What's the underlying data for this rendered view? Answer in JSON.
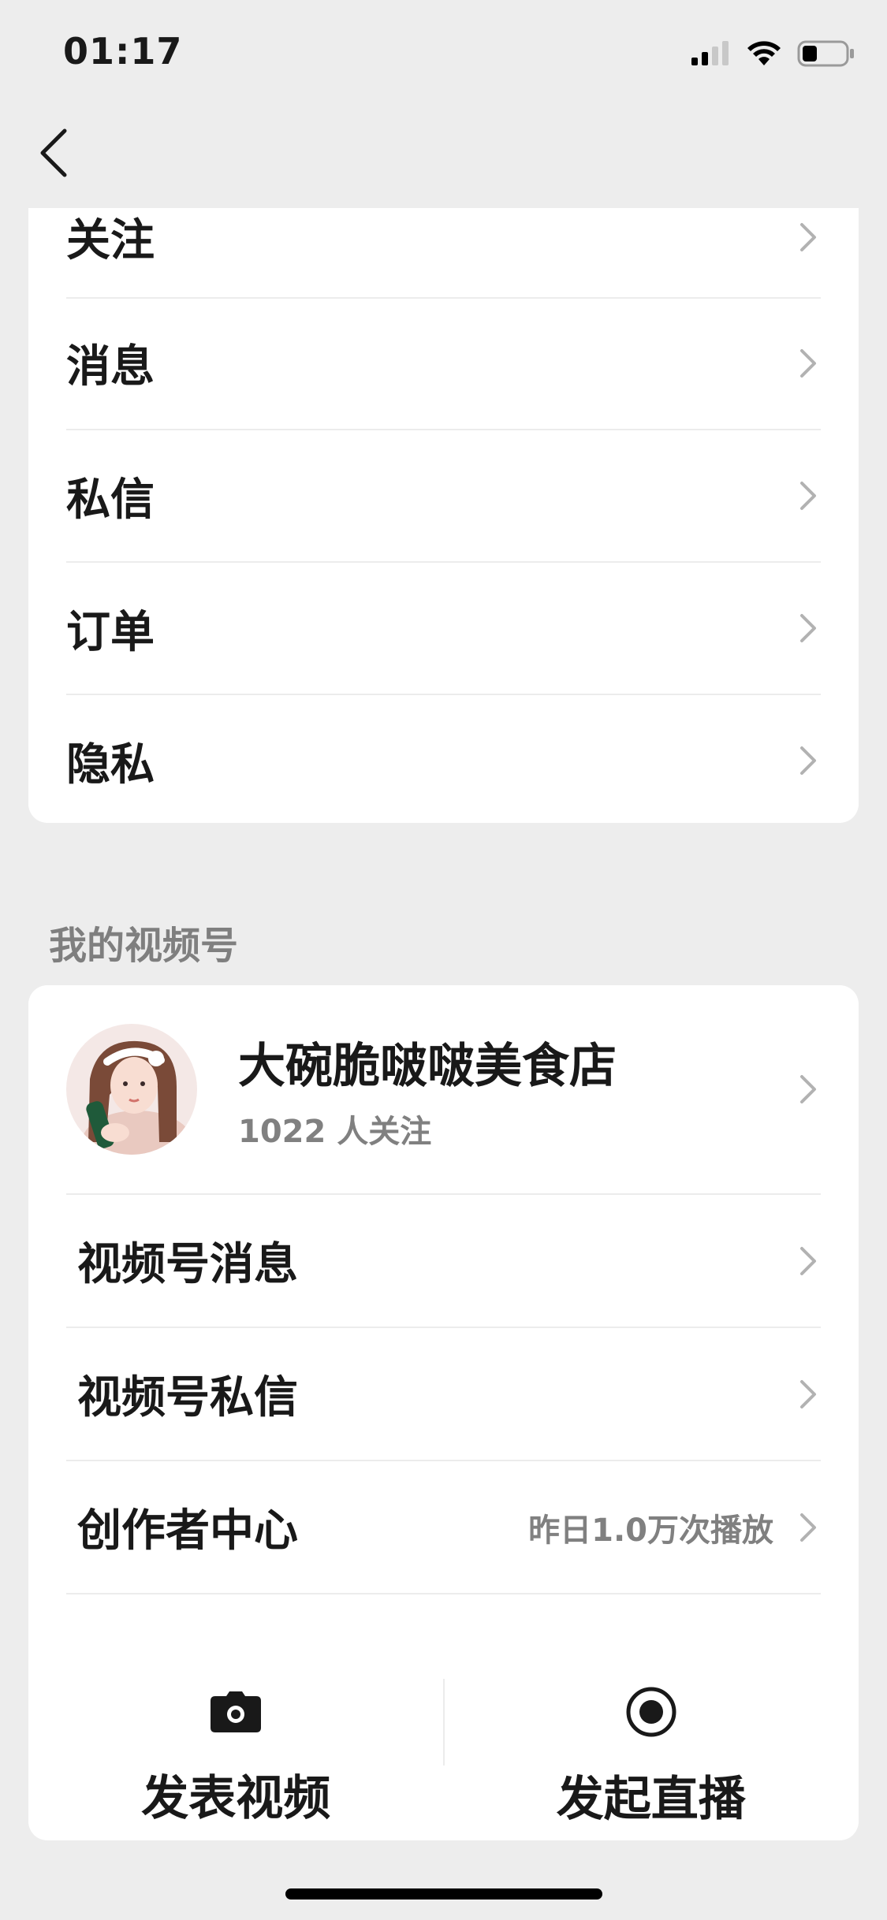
{
  "status_bar": {
    "time": "01:17",
    "icons": [
      "signal-icon",
      "wifi-icon",
      "battery-icon"
    ],
    "battery_level": 0.35
  },
  "nav": {
    "back_icon": "chevron-left-icon"
  },
  "top_menu": {
    "items": [
      {
        "label": "关注"
      },
      {
        "label": "消息"
      },
      {
        "label": "私信"
      },
      {
        "label": "订单"
      },
      {
        "label": "隐私"
      }
    ]
  },
  "channel": {
    "section_title": "我的视频号",
    "profile": {
      "name": "大碗脆啵啵美食店",
      "followers": "1022 人关注"
    },
    "items": [
      {
        "label": "视频号消息",
        "extra": ""
      },
      {
        "label": "视频号私信",
        "extra": ""
      },
      {
        "label": "创作者中心",
        "extra": "昨日1.0万次播放"
      }
    ],
    "actions": [
      {
        "label": "发表视频",
        "icon": "camera-icon"
      },
      {
        "label": "发起直播",
        "icon": "live-record-icon"
      }
    ]
  },
  "colors": {
    "background": "#ededed",
    "card": "#ffffff",
    "text_primary": "#191919",
    "text_secondary": "#808080"
  }
}
